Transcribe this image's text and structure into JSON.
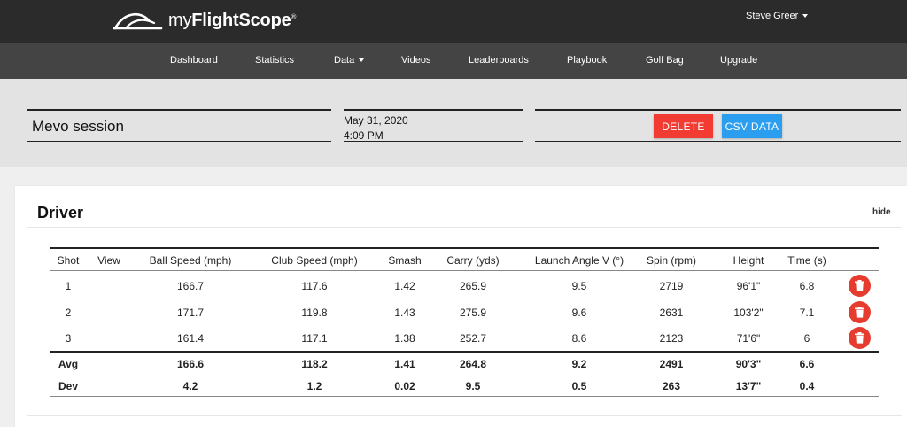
{
  "header": {
    "logo_text_light": "my",
    "logo_text_bold": "FlightScope",
    "logo_mark": "®",
    "user_name": "Steve Greer"
  },
  "nav": {
    "items": [
      {
        "label": "Dashboard"
      },
      {
        "label": "Statistics"
      },
      {
        "label": "Data",
        "dropdown": true
      },
      {
        "label": "Videos"
      },
      {
        "label": "Leaderboards"
      },
      {
        "label": "Playbook"
      },
      {
        "label": "Golf Bag"
      },
      {
        "label": "Upgrade"
      }
    ]
  },
  "session": {
    "name": "Mevo session",
    "date": "May 31, 2020",
    "time": "4:09 PM",
    "delete_label": "DELETE",
    "csv_label": "CSV DATA"
  },
  "club": {
    "title": "Driver",
    "hide_label": "hide"
  },
  "table": {
    "headers": [
      "Shot",
      "View",
      "Ball Speed (mph)",
      "Club Speed (mph)",
      "Smash",
      "Carry (yds)",
      "Launch Angle V (°)",
      "Spin (rpm)",
      "Height",
      "Time (s)"
    ],
    "rows": [
      [
        "1",
        "",
        "166.7",
        "117.6",
        "1.42",
        "265.9",
        "9.5",
        "2719",
        "96'1\"",
        "6.8"
      ],
      [
        "2",
        "",
        "171.7",
        "119.8",
        "1.43",
        "275.9",
        "9.6",
        "2631",
        "103'2\"",
        "7.1"
      ],
      [
        "3",
        "",
        "161.4",
        "117.1",
        "1.38",
        "252.7",
        "8.6",
        "2123",
        "71'6\"",
        "6"
      ]
    ],
    "summary": [
      [
        "Avg",
        "",
        "166.6",
        "118.2",
        "1.41",
        "264.8",
        "9.2",
        "2491",
        "90'3\"",
        "6.6"
      ],
      [
        "Dev",
        "",
        "4.2",
        "1.2",
        "0.02",
        "9.5",
        "0.5",
        "263",
        "13'7\"",
        "0.4"
      ]
    ]
  },
  "colors": {
    "topbar": "#2b2b2b",
    "navbar": "#444444",
    "delete": "#f13b33",
    "csv": "#2b9ef0",
    "trash": "#e63c2f"
  },
  "icons": {
    "trash": "trash-icon",
    "dropdown": "caret-down-icon"
  }
}
